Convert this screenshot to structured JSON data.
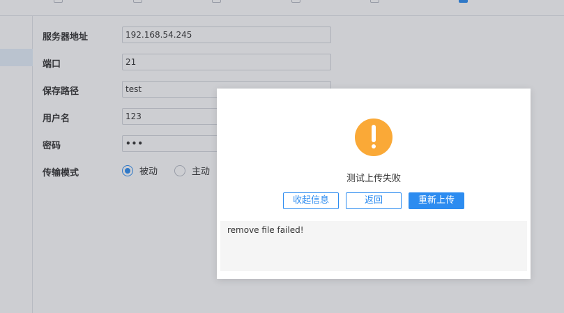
{
  "form": {
    "server_label": "服务器地址",
    "server_value": "192.168.54.245",
    "port_label": "端口",
    "port_value": "21",
    "path_label": "保存路径",
    "path_value": "test",
    "user_label": "用户名",
    "user_value": "123",
    "password_label": "密码",
    "password_value": "•••",
    "mode_label": "传输模式",
    "mode_options": [
      "被动",
      "主动"
    ],
    "mode_selected": "被动"
  },
  "dialog": {
    "icon": "warning-icon",
    "icon_color": "#faa937",
    "message": "测试上传失败",
    "collapse_label": "收起信息",
    "back_label": "返回",
    "reupload_label": "重新上传",
    "log_text": "remove file failed!"
  },
  "colors": {
    "accent": "#2d8cf0",
    "warning": "#faa937"
  }
}
